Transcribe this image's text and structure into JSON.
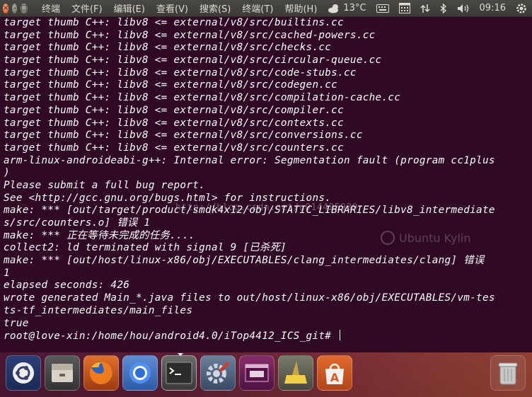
{
  "window": {
    "close_glyph": "×",
    "minimize_glyph": "–",
    "maximize_glyph": "□"
  },
  "menu": [
    "终端",
    "文件(F)",
    "编辑(E)",
    "查看(V)",
    "搜索(S)",
    "终端(T)",
    "帮助(H)"
  ],
  "tray": {
    "weather_icon": "weather-cloudy-icon",
    "temperature": "13°C",
    "clock": "09:16"
  },
  "terminal": {
    "lines": [
      "target thumb C++: libv8 <= external/v8/src/builtins.cc",
      "target thumb C++: libv8 <= external/v8/src/cached-powers.cc",
      "target thumb C++: libv8 <= external/v8/src/checks.cc",
      "target thumb C++: libv8 <= external/v8/src/circular-queue.cc",
      "target thumb C++: libv8 <= external/v8/src/code-stubs.cc",
      "target thumb C++: libv8 <= external/v8/src/codegen.cc",
      "target thumb C++: libv8 <= external/v8/src/compilation-cache.cc",
      "target thumb C++: libv8 <= external/v8/src/compiler.cc",
      "target thumb C++: libv8 <= external/v8/src/contexts.cc",
      "target thumb C++: libv8 <= external/v8/src/conversions.cc",
      "target thumb C++: libv8 <= external/v8/src/counters.cc",
      "arm-linux-androideabi-g++: Internal error: Segmentation fault (program cc1plus",
      ")",
      "Please submit a full bug report.",
      "See <http://gcc.gnu.org/bugs.html> for instructions.",
      "make: *** [out/target/product/smdk4x12/obj/STATIC_LIBRARIES/libv8_intermediate",
      "s/src/counters.o] 错误 1",
      "make: *** 正在等待未完成的任务....",
      "collect2: ld terminated with signal 9 [已杀死]",
      "make: *** [out/host/linux-x86/obj/EXECUTABLES/clang_intermediates/clang] 错误",
      "1",
      "elapsed seconds: 426",
      "wrote generated Main_*.java files to out/host/linux-x86/obj/EXECUTABLES/vm-tes",
      "ts-tf_intermediates/main_files",
      "true"
    ],
    "prompt": "root@love-xin:/home/hou/android4.0/iTop4412_ICS_git# ",
    "watermark_url": "http://blog.csdn.net/u014425939",
    "watermark_brand": "Ubuntu Kylin"
  },
  "dock": {
    "items": [
      {
        "name": "dash-home-icon",
        "label": "Dash"
      },
      {
        "name": "files-icon",
        "label": "Files"
      },
      {
        "name": "firefox-icon",
        "label": "Firefox"
      },
      {
        "name": "chromium-icon",
        "label": "Chromium"
      },
      {
        "name": "terminal-icon",
        "label": "Terminal"
      },
      {
        "name": "system-settings-icon",
        "label": "System Settings"
      },
      {
        "name": "workspace-switcher-icon",
        "label": "Workspaces"
      },
      {
        "name": "cleaner-icon",
        "label": "Cleaner"
      },
      {
        "name": "software-center-icon",
        "label": "Software Center"
      }
    ],
    "trash": {
      "name": "trash-icon",
      "label": "Trash"
    }
  },
  "colors": {
    "terminal_bg": "#300a24",
    "terminal_fg": "#ffffff",
    "panel_bg": "#3c3b37",
    "close_button": "#e2521f"
  }
}
